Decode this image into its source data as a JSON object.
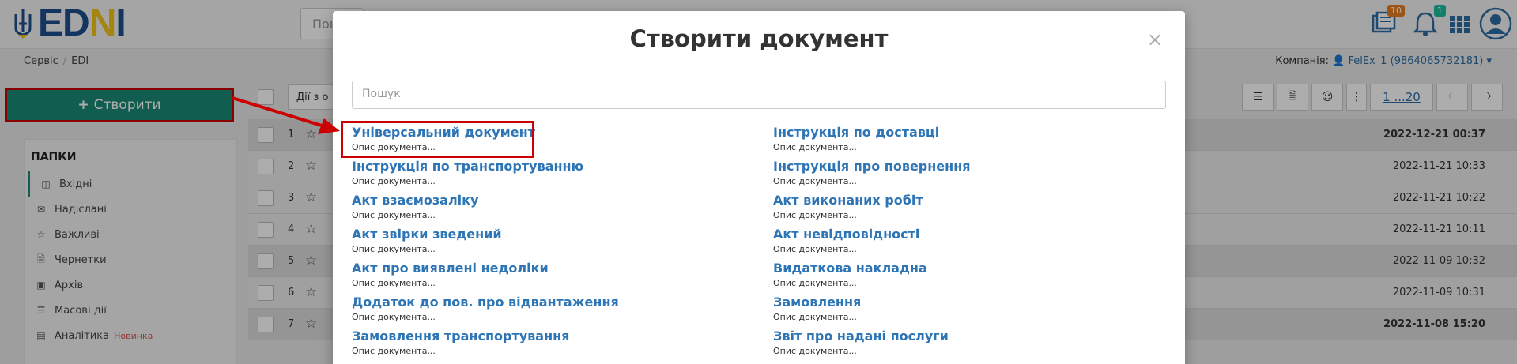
{
  "logo": {
    "text_main": "ED",
    "text_n": "N",
    "text_i": "I"
  },
  "top_search": {
    "placeholder": "Пош"
  },
  "top_icons": {
    "documents_badge": "10",
    "notifications_badge": "1"
  },
  "breadcrumb": {
    "items": [
      "Сервіс",
      "EDI"
    ]
  },
  "company": {
    "label": "Компанія:",
    "value": "FelEx_1 (9864065732181)"
  },
  "create_button": {
    "label": "Створити"
  },
  "folders": {
    "title": "ПАПКИ",
    "items": [
      {
        "label": "Вхідні",
        "icon": "inbox-icon"
      },
      {
        "label": "Надіслані",
        "icon": "envelope-icon"
      },
      {
        "label": "Важливі",
        "icon": "star-icon"
      },
      {
        "label": "Чернетки",
        "icon": "file-icon"
      },
      {
        "label": "Архів",
        "icon": "archive-icon"
      },
      {
        "label": "Масові дії",
        "icon": "list-icon"
      },
      {
        "label": "Аналітика",
        "icon": "chart-icon",
        "badge": "Новинка"
      }
    ]
  },
  "toolbar": {
    "actions_label": "Дії з о",
    "pager": "1 ...20"
  },
  "rows": [
    {
      "num": "1",
      "date": "2022-12-21 00:37",
      "bold": true
    },
    {
      "num": "2",
      "date": "2022-11-21 10:33",
      "bold": false
    },
    {
      "num": "3",
      "date": "2022-11-21 10:22",
      "bold": false
    },
    {
      "num": "4",
      "date": "2022-11-21 10:11",
      "bold": false
    },
    {
      "num": "5",
      "date": "2022-11-09 10:32",
      "bold": false
    },
    {
      "num": "6",
      "date": "2022-11-09 10:31",
      "bold": false
    },
    {
      "num": "7",
      "date": "2022-11-08 15:20",
      "bold": true
    }
  ],
  "modal": {
    "title": "Створити документ",
    "close": "×",
    "search_placeholder": "Пошук",
    "left_docs": [
      {
        "title": "Універсальний документ",
        "desc": "Опис документа..."
      },
      {
        "title": "Інструкція по транспортуванню",
        "desc": "Опис документа..."
      },
      {
        "title": "Акт взаємозаліку",
        "desc": "Опис документа..."
      },
      {
        "title": "Акт звірки зведений",
        "desc": "Опис документа..."
      },
      {
        "title": "Акт про виявлені недоліки",
        "desc": "Опис документа..."
      },
      {
        "title": "Додаток до пов. про відвантаження",
        "desc": "Опис документа..."
      },
      {
        "title": "Замовлення транспортування",
        "desc": "Опис документа..."
      }
    ],
    "right_docs": [
      {
        "title": "Інструкція по доставці",
        "desc": "Опис документа..."
      },
      {
        "title": "Інструкція про повернення",
        "desc": "Опис документа..."
      },
      {
        "title": "Акт виконаних робіт",
        "desc": "Опис документа..."
      },
      {
        "title": "Акт невідповідності",
        "desc": "Опис документа..."
      },
      {
        "title": "Видаткова накладна",
        "desc": "Опис документа..."
      },
      {
        "title": "Замовлення",
        "desc": "Опис документа..."
      },
      {
        "title": "Звіт про надані послуги",
        "desc": "Опис документа..."
      }
    ]
  }
}
